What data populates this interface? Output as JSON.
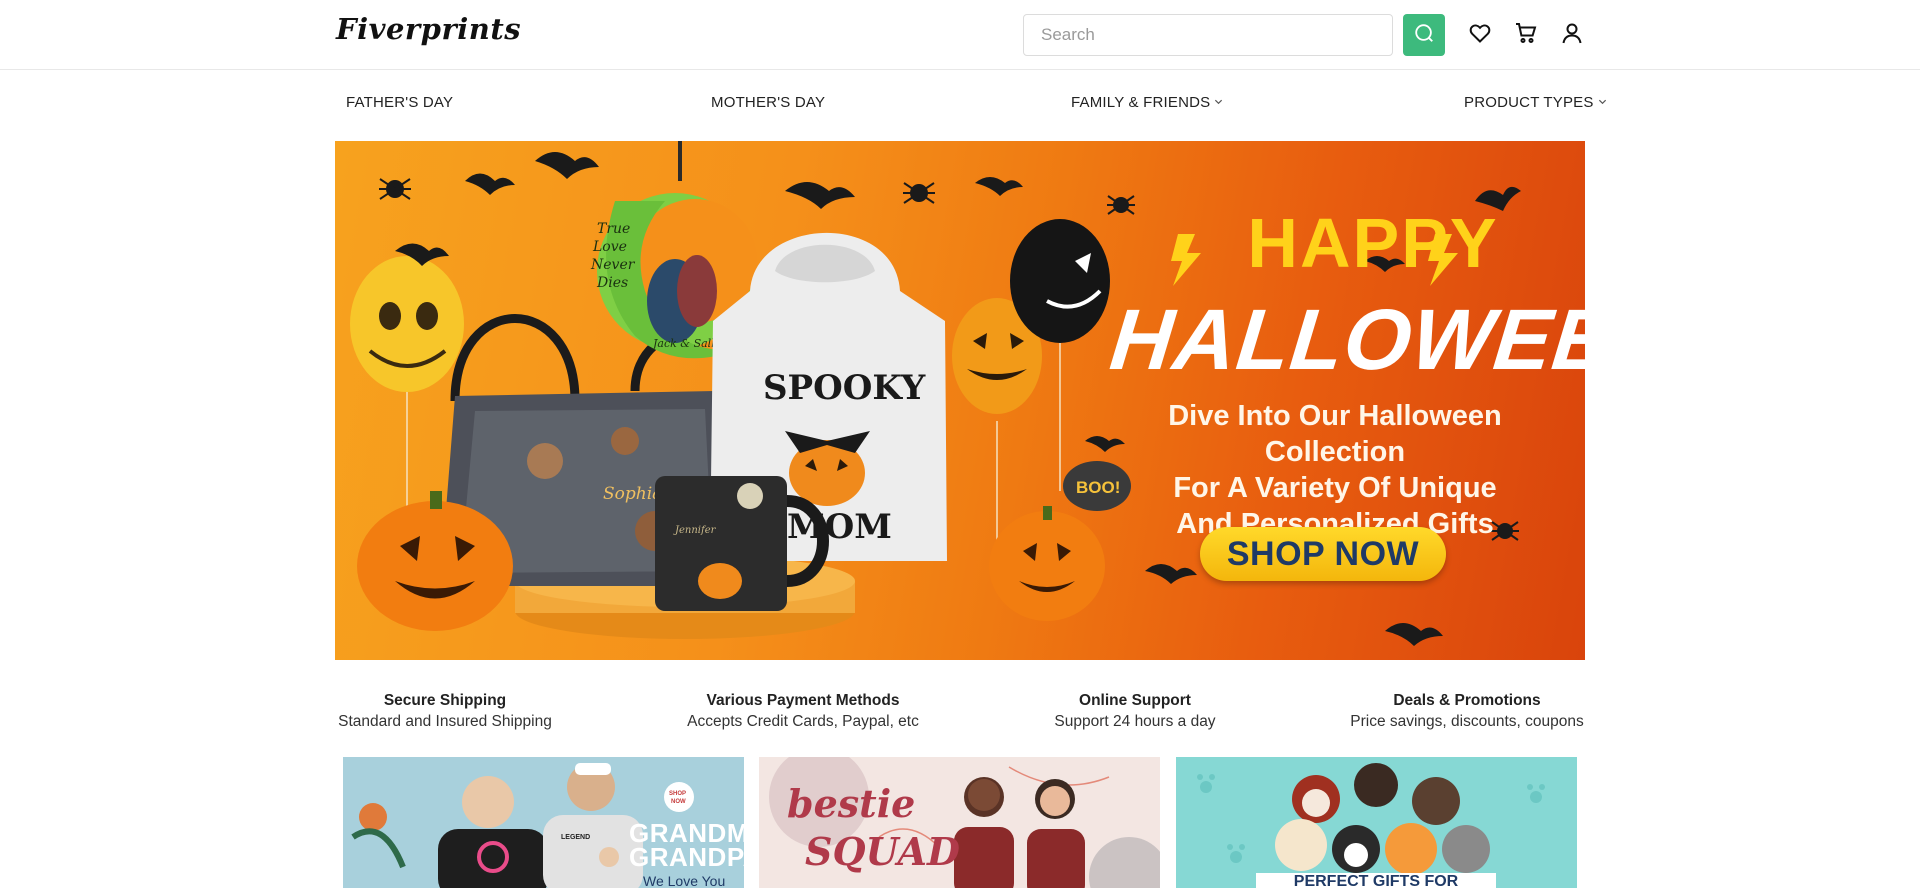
{
  "header": {
    "logo": "Fiverprints",
    "search_placeholder": "Search"
  },
  "nav": {
    "items": [
      {
        "label": "FATHER'S DAY",
        "has_dropdown": false
      },
      {
        "label": "MOTHER'S DAY",
        "has_dropdown": false
      },
      {
        "label": "FAMILY & FRIENDS",
        "has_dropdown": true
      },
      {
        "label": "PRODUCT TYPES",
        "has_dropdown": true
      }
    ]
  },
  "banner": {
    "headline_top": "HAPPY",
    "headline_main": "HALLOWEEN",
    "description_lines": [
      "Dive Into Our Halloween Collection",
      "For A Variety Of Unique",
      "And Personalized Gifts"
    ],
    "cta": "SHOP NOW",
    "hoodie_top": "SPOOKY",
    "hoodie_bottom": "MOM",
    "bag_name": "Sophia",
    "mug_name": "Jennifer",
    "balloon_text": "BOO!",
    "ornament_lines": [
      "True",
      "Love",
      "Never",
      "Dies"
    ],
    "ornament_names": "Jack & Sally"
  },
  "features": [
    {
      "title": "Secure Shipping",
      "subtitle": "Standard and Insured Shipping"
    },
    {
      "title": "Various Payment Methods",
      "subtitle": "Accepts Credit Cards, Paypal, etc"
    },
    {
      "title": "Online Support",
      "subtitle": "Support 24 hours a day"
    },
    {
      "title": "Deals & Promotions",
      "subtitle": "Price savings, discounts, coupons"
    }
  ],
  "cards": [
    {
      "title_line1": "GRANDMA",
      "title_line2": "GRANDPA",
      "subtitle": "We Love You",
      "badge": "SHOP NOW",
      "shirt_text": "LEGEND HUSBAND DADDY GRANDPA"
    },
    {
      "title_line1": "bestie",
      "title_line2": "SQUAD"
    },
    {
      "title": "PERFECT GIFTS FOR"
    }
  ],
  "colors": {
    "accent_green": "#3dba7d",
    "banner_orange": "#ef7a12",
    "cta_yellow": "#ffd21a",
    "cta_text_navy": "#1f3a66"
  },
  "icons": [
    "search-icon",
    "heart-icon",
    "cart-icon",
    "user-icon",
    "chevron-down-icon"
  ]
}
